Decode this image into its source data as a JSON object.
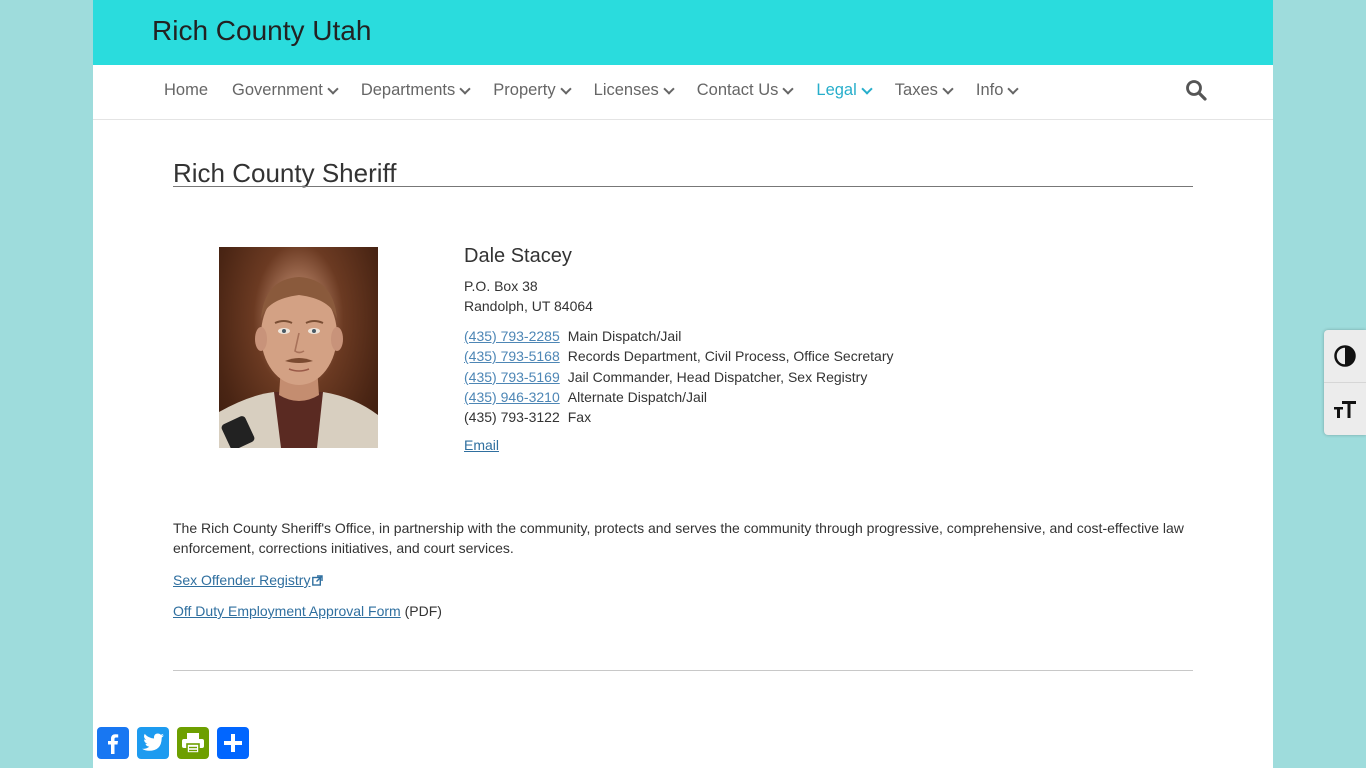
{
  "site": {
    "title": "Rich County Utah"
  },
  "nav": {
    "items": [
      {
        "label": "Home",
        "dropdown": false,
        "active": false
      },
      {
        "label": "Government",
        "dropdown": true,
        "active": false
      },
      {
        "label": "Departments",
        "dropdown": true,
        "active": false
      },
      {
        "label": "Property",
        "dropdown": true,
        "active": false
      },
      {
        "label": "Licenses",
        "dropdown": true,
        "active": false
      },
      {
        "label": "Contact Us",
        "dropdown": true,
        "active": false
      },
      {
        "label": "Legal",
        "dropdown": true,
        "active": true
      },
      {
        "label": "Taxes",
        "dropdown": true,
        "active": false
      },
      {
        "label": "Info",
        "dropdown": true,
        "active": false
      }
    ],
    "search_icon": "search-icon"
  },
  "page": {
    "title": "Rich County Sheriff"
  },
  "sheriff": {
    "name": "Dale Stacey",
    "address_line1": "P.O. Box 38",
    "address_line2": "Randolph, UT 84064",
    "phones": [
      {
        "number": "(435) 793-2285",
        "desc": "Main Dispatch/Jail",
        "link": true
      },
      {
        "number": "(435) 793-5168",
        "desc": "Records Department, Civil Process, Office Secretary",
        "link": true
      },
      {
        "number": "(435) 793-5169",
        "desc": "Jail Commander, Head Dispatcher, Sex Registry",
        "link": true
      },
      {
        "number": "(435) 946-3210",
        "desc": "Alternate Dispatch/Jail",
        "link": true
      },
      {
        "number": "(435) 793-3122",
        "desc": "Fax",
        "link": false
      }
    ],
    "email_label": "Email"
  },
  "about": {
    "text": "The Rich County Sheriff's Office, in partnership with the community, protects and serves the community through progressive, comprehensive, and cost-effective law enforcement, corrections initiatives, and court services."
  },
  "links": {
    "sex_offender": "Sex Offender Registry",
    "off_duty_form": "Off Duty Employment Approval Form",
    "pdf_note": "(PDF)"
  },
  "share": {
    "icons": [
      "facebook-icon",
      "twitter-icon",
      "printfriendly-icon",
      "share-icon"
    ],
    "colors": {
      "facebook": "#1877f2",
      "twitter": "#1d9bf0",
      "print": "#6d9f00",
      "share": "#0166ff"
    }
  },
  "accessibility": {
    "icons": [
      "contrast-icon",
      "font-size-icon"
    ]
  },
  "colors": {
    "header_bg": "#2adcdd",
    "page_bg": "#9edcdc",
    "nav_active": "#27aecb",
    "link": "#2f6f9f"
  }
}
